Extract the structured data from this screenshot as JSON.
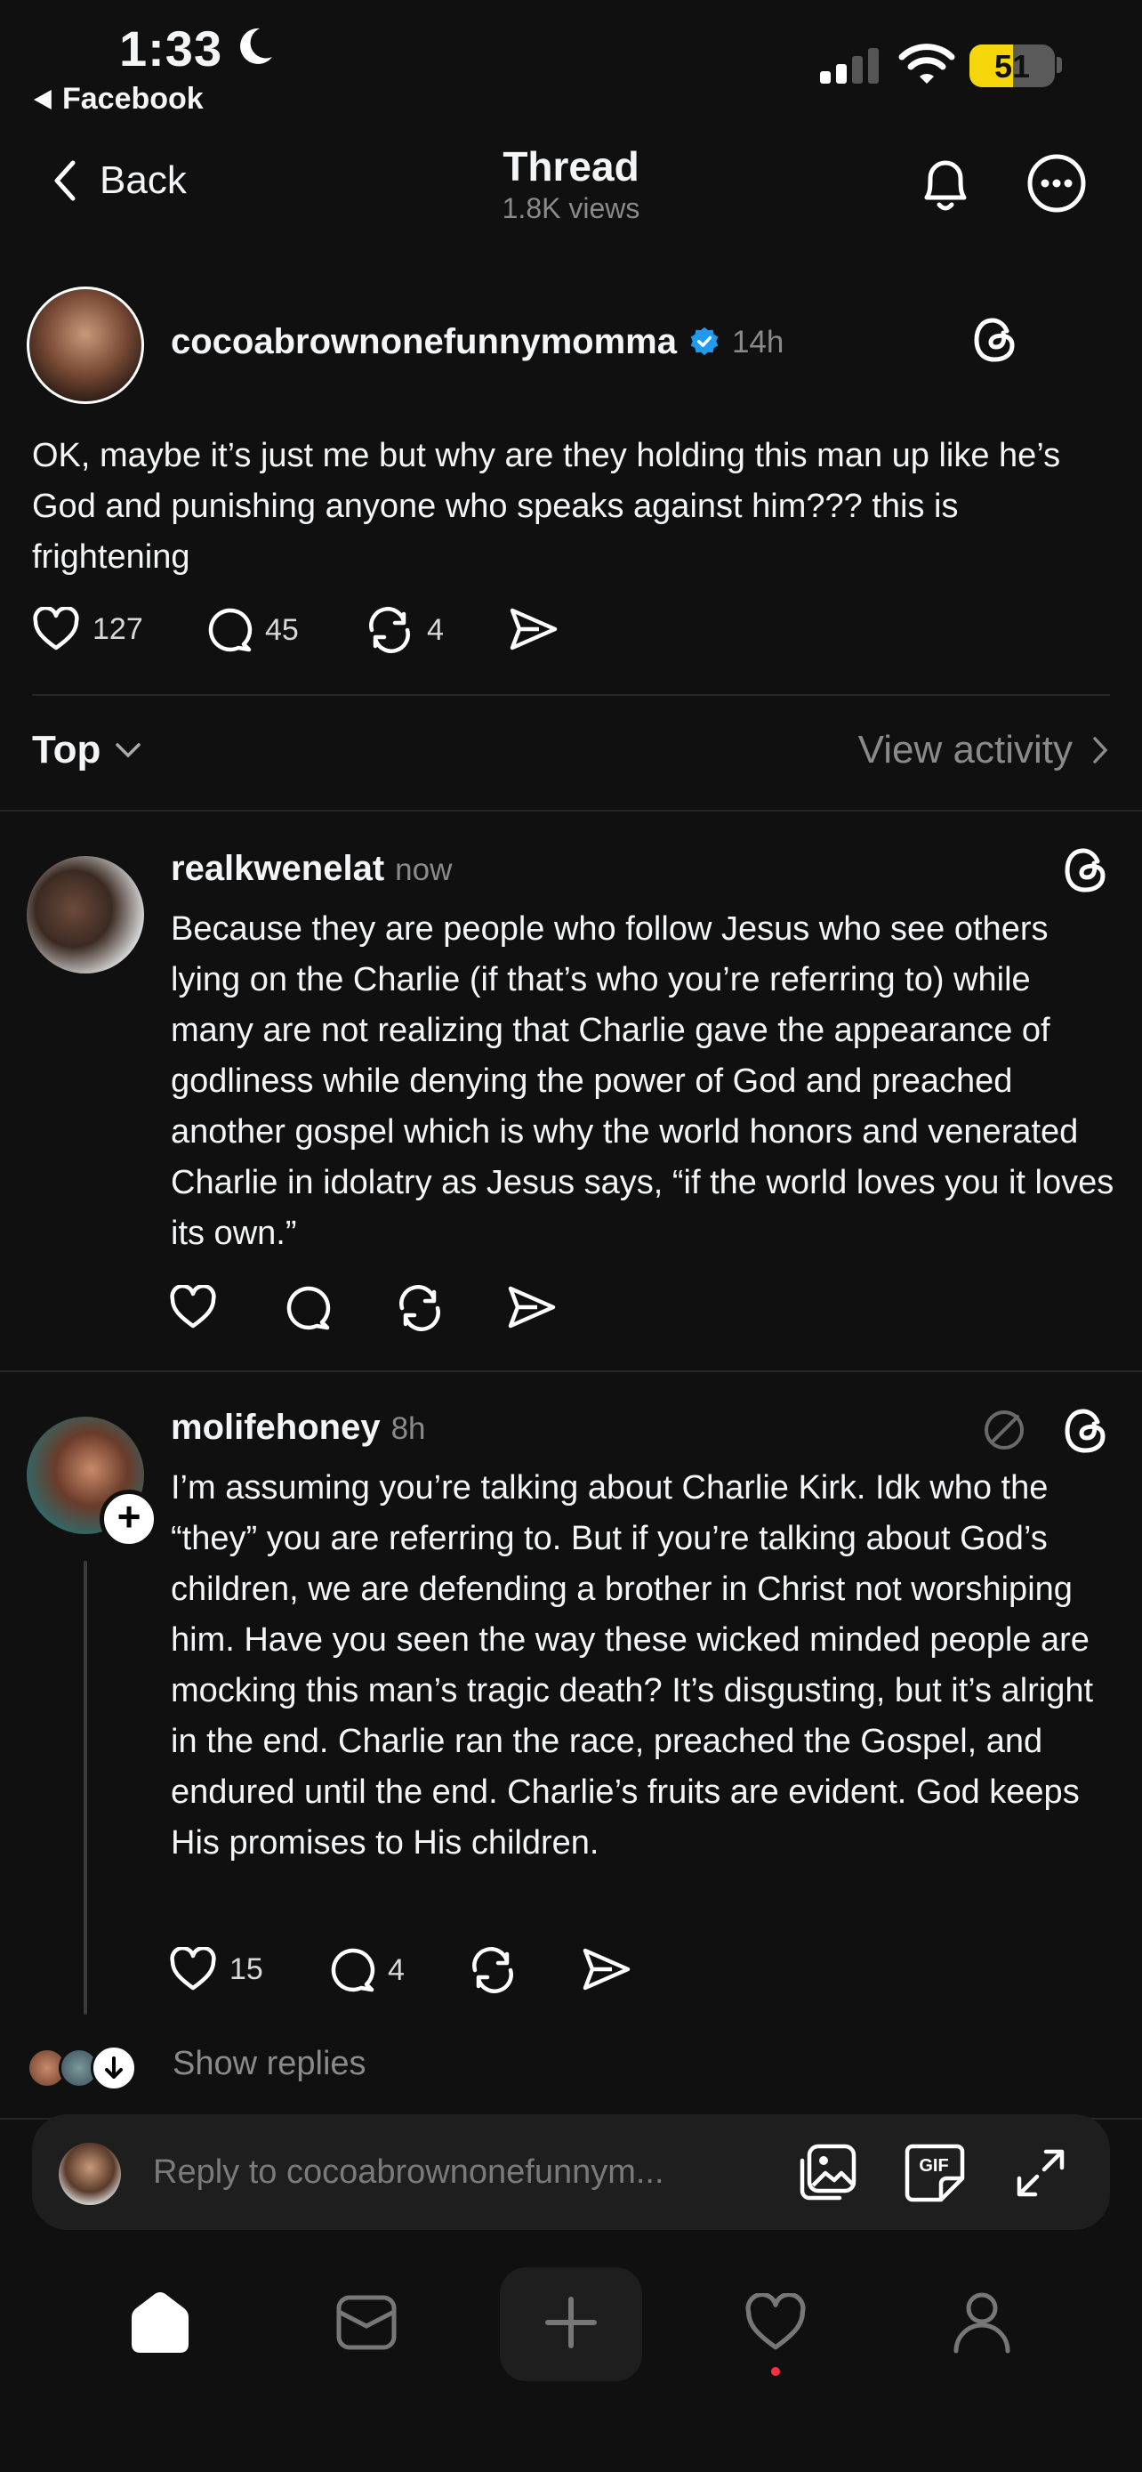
{
  "status_bar": {
    "time": "1:33",
    "back_app": "Facebook",
    "battery": "51",
    "battery_level": 0.51,
    "battery_color": "#f5d60a",
    "icons": [
      "moon-icon",
      "signal-icon",
      "wifi-icon",
      "battery-icon"
    ]
  },
  "header": {
    "back_label": "Back",
    "title": "Thread",
    "views": "1.8K views",
    "icons": [
      "bell-icon",
      "more-icon"
    ]
  },
  "main_post": {
    "username": "cocoabrownonefunnymomma",
    "verified": true,
    "time": "14h",
    "text": "OK, maybe it’s just me but why are they holding this man up like he’s God and punishing anyone who speaks against him??? this is frightening",
    "likes": "127",
    "comments": "45",
    "reposts": "4"
  },
  "sort": {
    "label": "Top",
    "view_activity": "View activity"
  },
  "replies": [
    {
      "username": "realkwenelat",
      "time": "now",
      "text": "Because they are people who follow Jesus who see others lying on the Charlie (if that’s who you’re referring to) while many are not realizing that Charlie gave the appearance of godliness while denying the power of God and preached another gospel which is why the world honors and venerated Charlie in idolatry as Jesus says, “if the world loves you it loves its own.”"
    },
    {
      "username": "molifehoney",
      "time": "8h",
      "text": "I’m assuming you’re talking about Charlie Kirk. Idk who the “they” you are referring to. But if you’re talking about God’s children, we are defending a brother in Christ not worshiping him. Have you seen the way these wicked minded people are mocking this man’s tragic death? It’s disgusting, but it’s alright in the end. Charlie ran the race, preached the Gospel, and endured until the end. Charlie’s fruits are evident. God keeps His promises to His children.",
      "likes": "15",
      "comments": "4",
      "show_replies": "Show replies"
    }
  ],
  "composer": {
    "placeholder": "Reply to cocoabrownonefunnym..."
  },
  "colors": {
    "background": "#101010",
    "text": "#f3f5f7",
    "muted": "#8a8a8a",
    "verified": "#1d9bf0",
    "notification_dot": "#ff3040"
  }
}
